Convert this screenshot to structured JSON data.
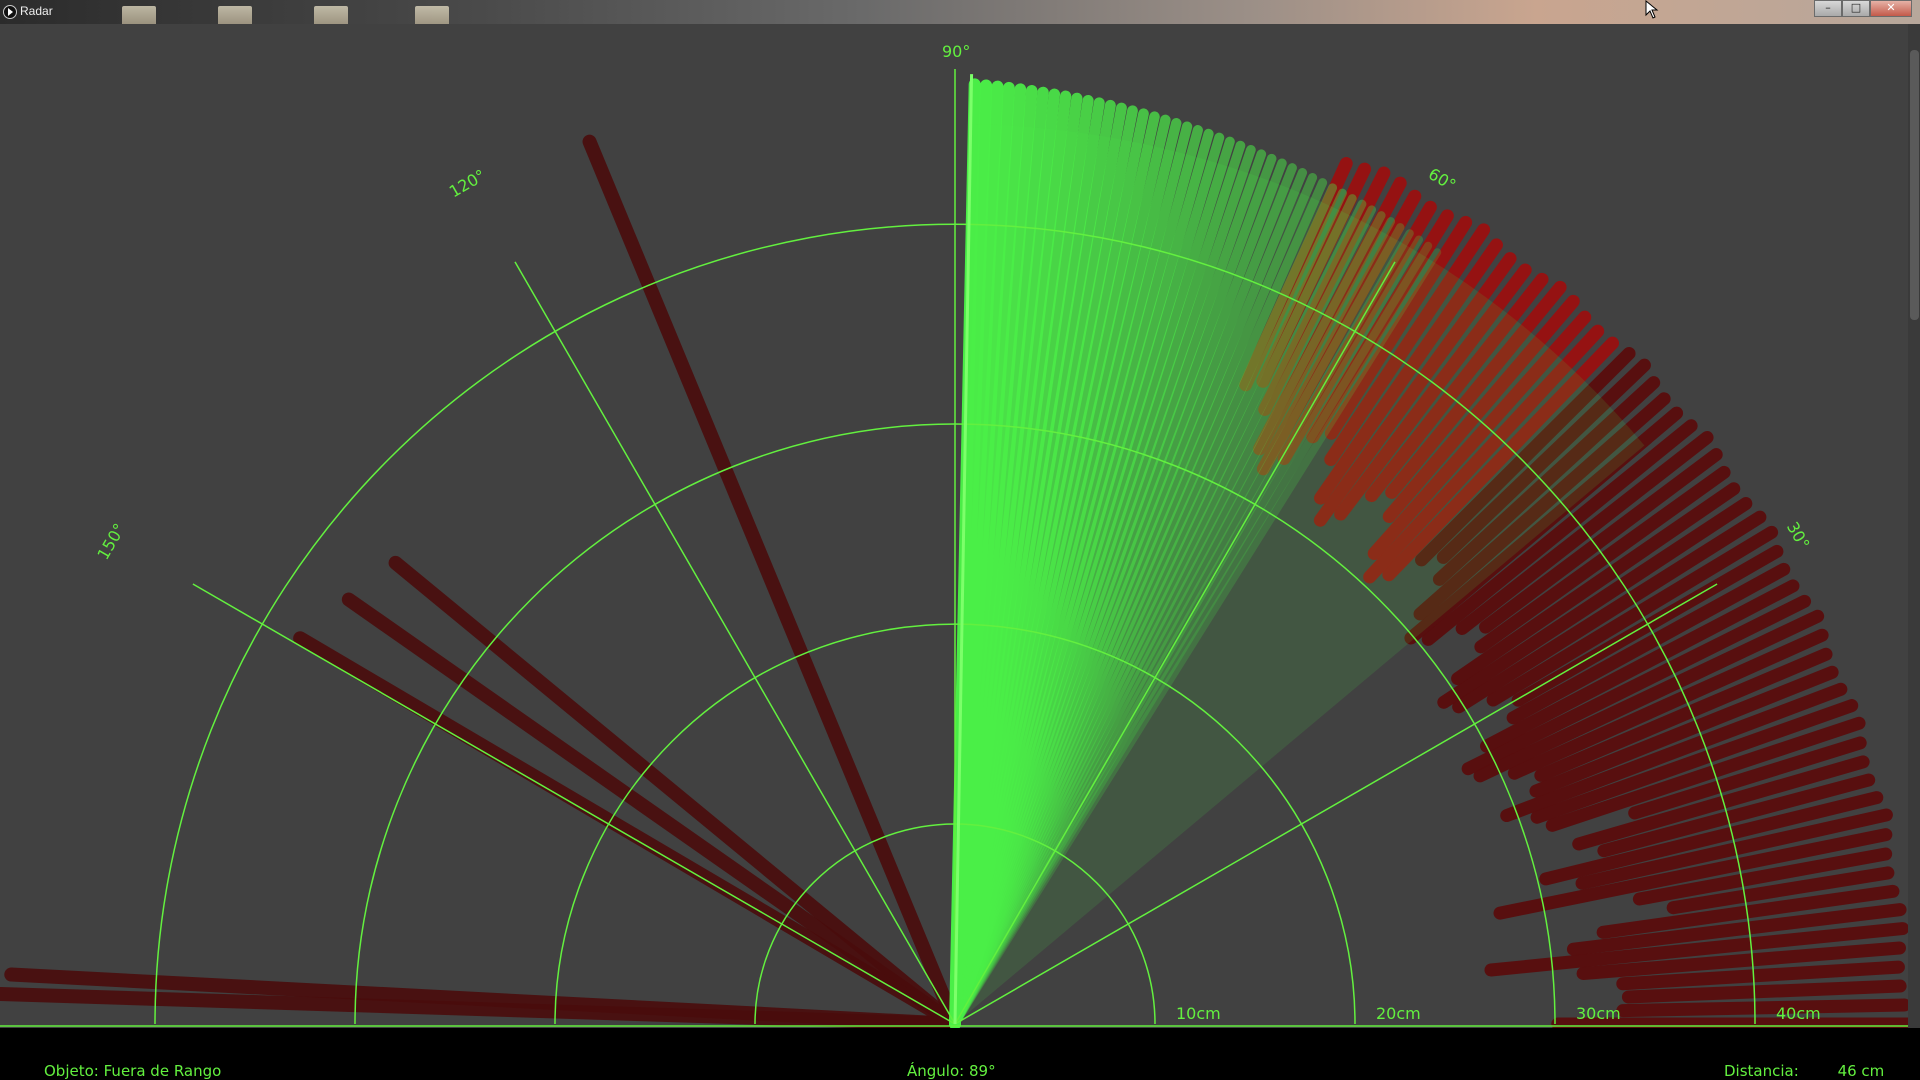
{
  "window": {
    "title": "Radar",
    "controls": [
      "–",
      "□",
      "✕"
    ]
  },
  "radar": {
    "angle_labels": [
      "90°",
      "120°",
      "60°",
      "150°",
      "30°"
    ],
    "distance_labels": [
      "10cm",
      "20cm",
      "30cm",
      "40cm"
    ],
    "sweep_angle_deg": 89,
    "max_range_cm": 40,
    "colors": {
      "grid": "#63f03f",
      "sweep": "#4bf048",
      "object": "#b01010",
      "background": "#414141"
    }
  },
  "status": {
    "object_label": "Objeto:",
    "object_value": "Fuera de Rango",
    "angle_label": "Ángulo:",
    "angle_value": "89°",
    "distance_label": "Distancia:",
    "distance_value": "46 cm"
  }
}
